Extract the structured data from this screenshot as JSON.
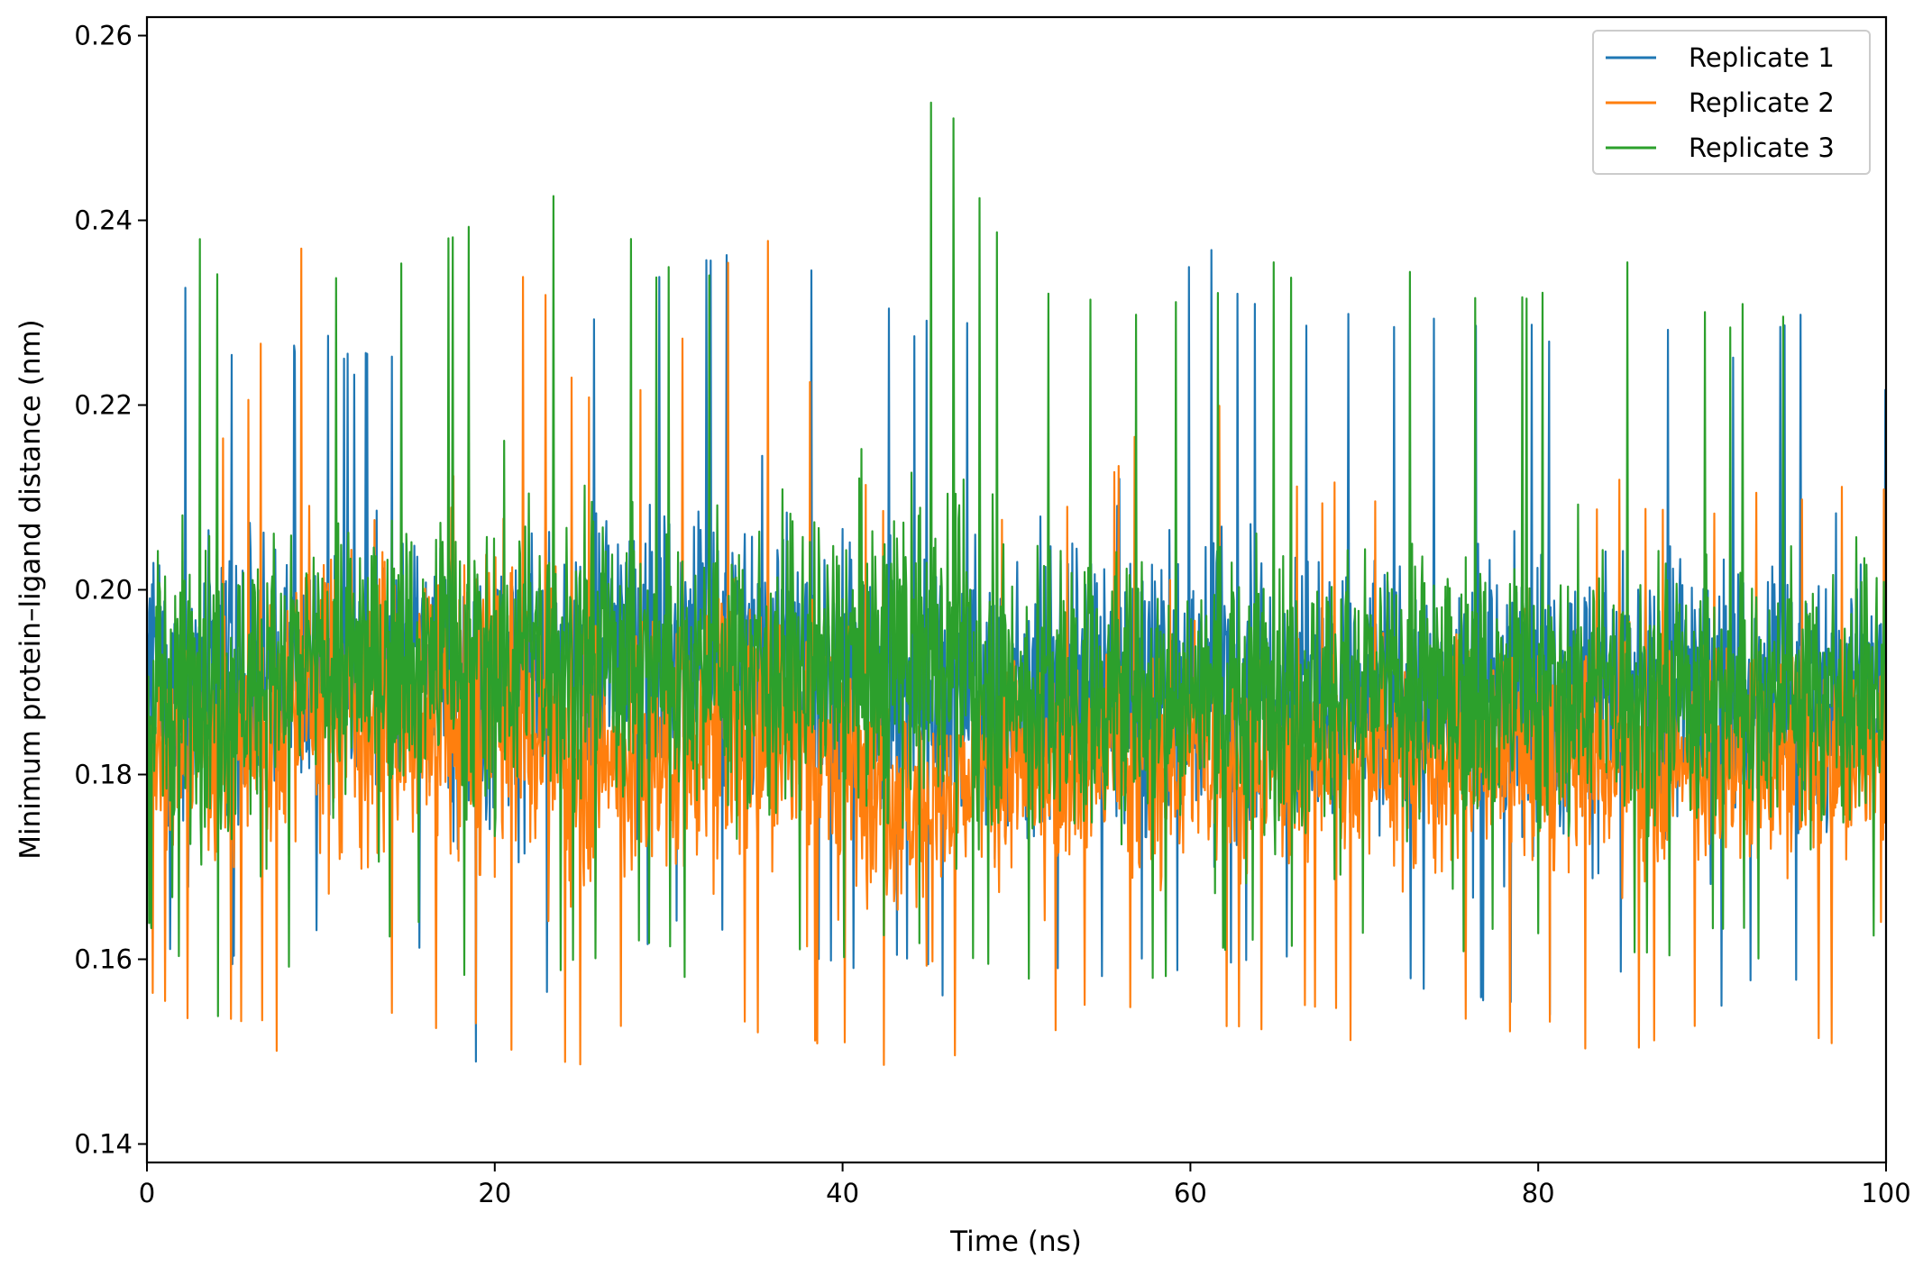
{
  "chart_data": {
    "type": "line",
    "title": "",
    "xlabel": "Time (ns)",
    "ylabel": "Minimum protein–ligand distance (nm)",
    "xlim": [
      0,
      100
    ],
    "ylim": [
      0.138,
      0.262
    ],
    "xticks": [
      0,
      20,
      40,
      60,
      80,
      100
    ],
    "xtick_labels": [
      "0",
      "20",
      "40",
      "60",
      "80",
      "100"
    ],
    "yticks": [
      0.14,
      0.16,
      0.18,
      0.2,
      0.22,
      0.24,
      0.26
    ],
    "ytick_labels": [
      "0.14",
      "0.16",
      "0.18",
      "0.20",
      "0.22",
      "0.24",
      "0.26"
    ],
    "grid": false,
    "legend_position": "top-right",
    "series": [
      {
        "name": "Replicate 1",
        "color": "#1f77b4",
        "x": [
          0,
          5,
          10,
          15,
          20,
          25,
          30,
          35,
          40,
          45,
          50,
          55,
          60,
          65,
          70,
          75,
          80,
          85,
          90,
          95,
          100
        ],
        "mean": [
          0.189,
          0.19,
          0.191,
          0.192,
          0.19,
          0.193,
          0.195,
          0.194,
          0.191,
          0.19,
          0.189,
          0.189,
          0.189,
          0.189,
          0.189,
          0.189,
          0.189,
          0.189,
          0.189,
          0.189,
          0.189
        ],
        "max": [
          0.237,
          0.228,
          0.228,
          0.226,
          0.226,
          0.232,
          0.237,
          0.236,
          0.236,
          0.23,
          0.233,
          0.232,
          0.238,
          0.233,
          0.231,
          0.23,
          0.229,
          0.236,
          0.227,
          0.23,
          0.223
        ],
        "min": [
          0.158,
          0.159,
          0.161,
          0.16,
          0.144,
          0.16,
          0.161,
          0.16,
          0.159,
          0.156,
          0.156,
          0.157,
          0.158,
          0.157,
          0.158,
          0.156,
          0.152,
          0.156,
          0.154,
          0.155,
          0.158
        ]
      },
      {
        "name": "Replicate 2",
        "color": "#ff7f0e",
        "x": [
          0,
          5,
          10,
          15,
          20,
          25,
          30,
          35,
          40,
          45,
          50,
          55,
          60,
          65,
          70,
          75,
          80,
          85,
          90,
          95,
          100
        ],
        "mean": [
          0.184,
          0.183,
          0.19,
          0.185,
          0.188,
          0.182,
          0.183,
          0.186,
          0.182,
          0.176,
          0.181,
          0.182,
          0.182,
          0.182,
          0.182,
          0.182,
          0.182,
          0.182,
          0.182,
          0.182,
          0.182
        ],
        "max": [
          0.21,
          0.22,
          0.245,
          0.228,
          0.243,
          0.224,
          0.226,
          0.243,
          0.212,
          0.211,
          0.211,
          0.212,
          0.225,
          0.214,
          0.212,
          0.212,
          0.211,
          0.212,
          0.212,
          0.212,
          0.212
        ],
        "min": [
          0.156,
          0.15,
          0.15,
          0.152,
          0.15,
          0.146,
          0.154,
          0.152,
          0.149,
          0.145,
          0.151,
          0.152,
          0.152,
          0.152,
          0.151,
          0.151,
          0.151,
          0.148,
          0.15,
          0.15,
          0.152
        ]
      },
      {
        "name": "Replicate 3",
        "color": "#2ca02c",
        "x": [
          0,
          5,
          10,
          15,
          20,
          25,
          30,
          35,
          40,
          45,
          50,
          55,
          60,
          65,
          70,
          75,
          80,
          85,
          90,
          95,
          100
        ],
        "mean": [
          0.189,
          0.19,
          0.191,
          0.193,
          0.192,
          0.194,
          0.192,
          0.192,
          0.191,
          0.193,
          0.189,
          0.189,
          0.189,
          0.189,
          0.189,
          0.189,
          0.189,
          0.189,
          0.189,
          0.189,
          0.189
        ],
        "max": [
          0.242,
          0.236,
          0.237,
          0.238,
          0.24,
          0.246,
          0.236,
          0.237,
          0.233,
          0.256,
          0.238,
          0.232,
          0.232,
          0.236,
          0.241,
          0.235,
          0.232,
          0.237,
          0.232,
          0.232,
          0.225
        ],
        "min": [
          0.163,
          0.15,
          0.16,
          0.162,
          0.152,
          0.16,
          0.158,
          0.158,
          0.159,
          0.161,
          0.155,
          0.153,
          0.16,
          0.16,
          0.16,
          0.16,
          0.16,
          0.16,
          0.16,
          0.16,
          0.16
        ]
      }
    ]
  }
}
